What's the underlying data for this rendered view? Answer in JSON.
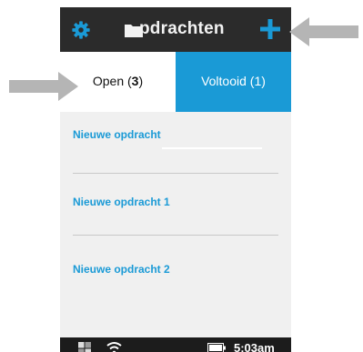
{
  "header": {
    "title": "Opdrachten",
    "title_visible": "pdrachten",
    "left_icon": "gear-icon",
    "folder_icon": "folder-icon",
    "right_icon": "plus-icon"
  },
  "tabs": [
    {
      "label": "Open (",
      "count": "3",
      "suffix": ")",
      "active": true
    },
    {
      "label": "Voltooid (1)",
      "active": false
    }
  ],
  "list": {
    "items": [
      {
        "label": "Nieuwe opdracht"
      },
      {
        "label": "Nieuwe opdracht 1"
      },
      {
        "label": "Nieuwe opdracht 2"
      }
    ]
  },
  "status_bar": {
    "time": "5:03am",
    "icons": [
      "windows-icon",
      "wifi-icon",
      "battery-icon"
    ]
  },
  "annotations": {
    "arrows": [
      "arrow-to-plus-icon",
      "arrow-to-open-tab"
    ]
  },
  "colors": {
    "accent": "#1a9ad6",
    "header_bg": "#2b2b2b",
    "list_bg": "#f0f0f0",
    "status_bg": "#1c1c1c",
    "arrow": "#b5b5b5"
  }
}
